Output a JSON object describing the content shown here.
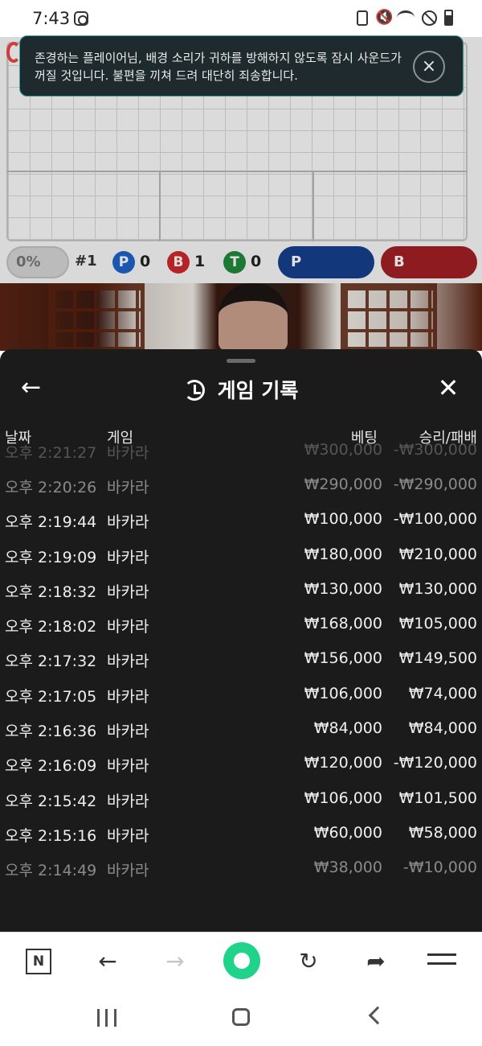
{
  "status_bar": {
    "time": "7:43"
  },
  "toast": {
    "message": "존경하는 플레이어님, 배경 소리가 귀하를 방해하지 않도록 잠시 사운드가 꺼질 것입니다. 불편을 끼쳐 드려 대단히 죄송합니다.",
    "close": "×"
  },
  "game": {
    "percent": "0%",
    "round": "#1",
    "player_label": "P",
    "player_count": "0",
    "banker_label": "B",
    "banker_count": "1",
    "tie_label": "T",
    "tie_count": "0",
    "bet_player": "P",
    "bet_banker": "B",
    "colors": {
      "player": "#1f64c8",
      "banker": "#d0282c",
      "tie": "#1f8a3c"
    }
  },
  "history": {
    "title": "게임 기록",
    "back": "←",
    "close": "✕",
    "columns": {
      "date": "날짜",
      "game": "게임",
      "bet": "베팅",
      "result": "승리/패배"
    },
    "rows": [
      {
        "date": "오후 2:21:27",
        "game": "바카라",
        "bet": "₩300,000",
        "result": "-₩300,000"
      },
      {
        "date": "오후 2:20:26",
        "game": "바카라",
        "bet": "₩290,000",
        "result": "-₩290,000"
      },
      {
        "date": "오후 2:19:44",
        "game": "바카라",
        "bet": "₩100,000",
        "result": "-₩100,000"
      },
      {
        "date": "오후 2:19:09",
        "game": "바카라",
        "bet": "₩180,000",
        "result": "₩210,000"
      },
      {
        "date": "오후 2:18:32",
        "game": "바카라",
        "bet": "₩130,000",
        "result": "₩130,000"
      },
      {
        "date": "오후 2:18:02",
        "game": "바카라",
        "bet": "₩168,000",
        "result": "₩105,000"
      },
      {
        "date": "오후 2:17:32",
        "game": "바카라",
        "bet": "₩156,000",
        "result": "₩149,500"
      },
      {
        "date": "오후 2:17:05",
        "game": "바카라",
        "bet": "₩106,000",
        "result": "₩74,000"
      },
      {
        "date": "오후 2:16:36",
        "game": "바카라",
        "bet": "₩84,000",
        "result": "₩84,000"
      },
      {
        "date": "오후 2:16:09",
        "game": "바카라",
        "bet": "₩120,000",
        "result": "-₩120,000"
      },
      {
        "date": "오후 2:15:42",
        "game": "바카라",
        "bet": "₩106,000",
        "result": "₩101,500"
      },
      {
        "date": "오후 2:15:16",
        "game": "바카라",
        "bet": "₩60,000",
        "result": "₩58,000"
      },
      {
        "date": "오후 2:14:49",
        "game": "바카라",
        "bet": "₩38,000",
        "result": "-₩10,000"
      }
    ]
  },
  "browser_bar": {
    "naver": "N",
    "back": "←",
    "forward": "→",
    "reload": "↻",
    "share": "➦"
  },
  "icons": [
    "instagram-icon",
    "sim-icon",
    "mute-icon",
    "wifi-icon",
    "block-icon",
    "battery-icon",
    "history-icon",
    "arrow-left-icon",
    "close-icon",
    "home-icon",
    "menu-icon"
  ]
}
